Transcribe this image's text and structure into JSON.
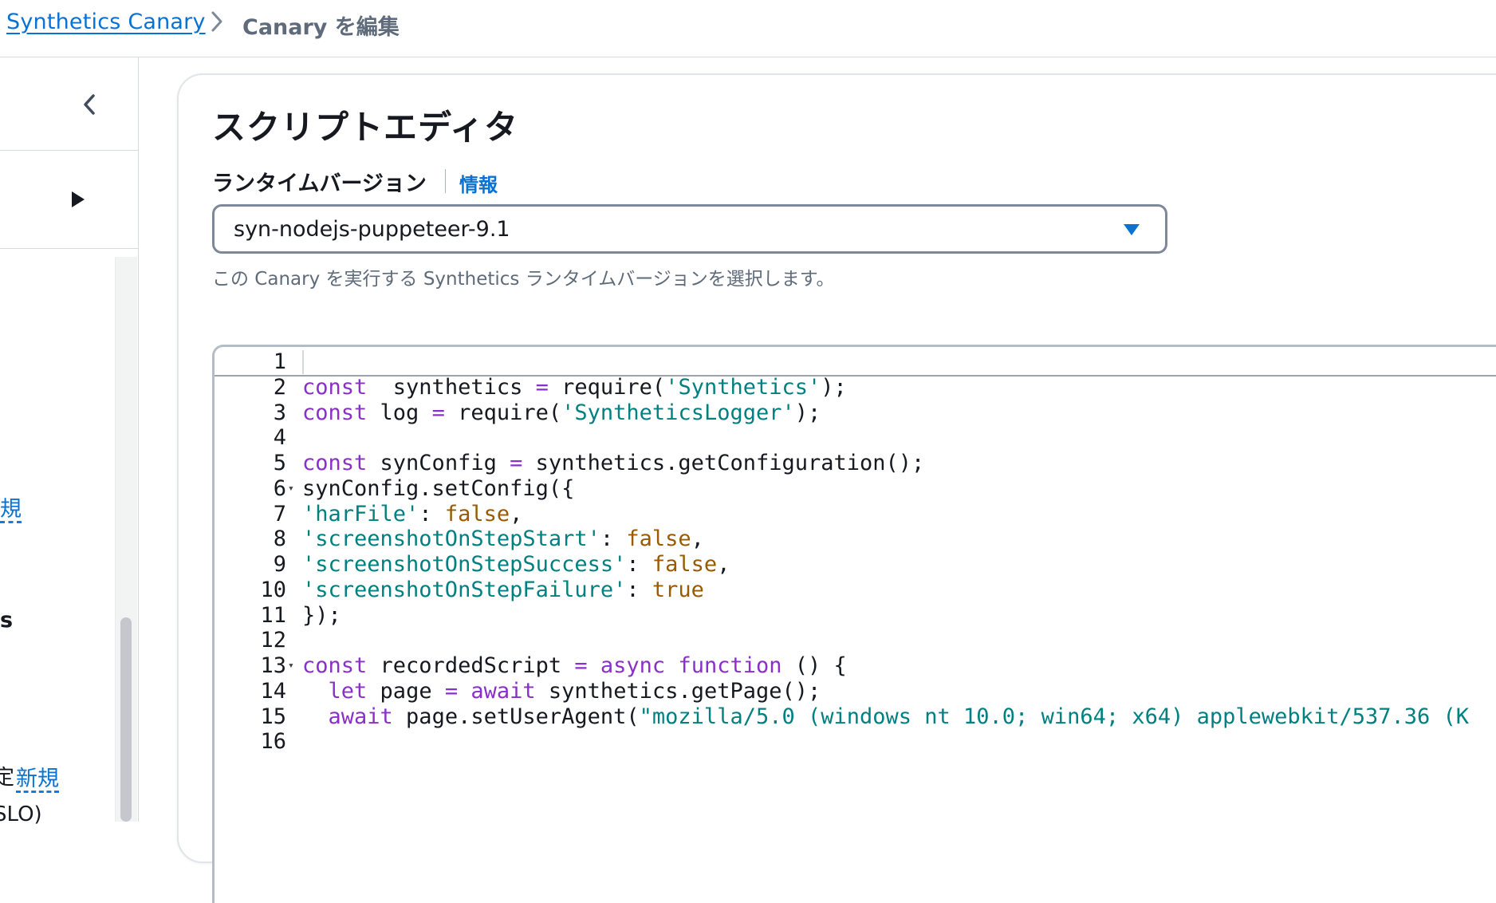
{
  "breadcrumb": {
    "parent": "Synthetics Canary",
    "current": "Canary を編集"
  },
  "sidebar": {
    "fragments": {
      "link_a": "規",
      "bold_text": "s",
      "text_b": "定",
      "link_b": "新規",
      "text_c": "SLO)"
    }
  },
  "script_editor": {
    "title": "スクリプトエディタ",
    "runtime_label": "ランタイムバージョン",
    "info_link": "情報",
    "runtime_value": "syn-nodejs-puppeteer-9.1",
    "runtime_description": "この Canary を実行する Synthetics ランタイムバージョンを選択します。"
  },
  "code": {
    "line_numbers": [
      "1",
      "2",
      "3",
      "4",
      "5",
      "6",
      "7",
      "8",
      "9",
      "10",
      "11",
      "12",
      "13",
      "14",
      "15",
      "16"
    ],
    "lines": [
      [],
      [
        [
          "kw",
          "const"
        ],
        [
          "",
          "  synthetics "
        ],
        [
          "op",
          "="
        ],
        [
          "",
          " require("
        ],
        [
          "str",
          "'Synthetics'"
        ],
        [
          "",
          ");"
        ]
      ],
      [
        [
          "kw",
          "const"
        ],
        [
          "",
          " log "
        ],
        [
          "op",
          "="
        ],
        [
          "",
          " require("
        ],
        [
          "str",
          "'SyntheticsLogger'"
        ],
        [
          "",
          ");"
        ]
      ],
      [],
      [
        [
          "kw",
          "const"
        ],
        [
          "",
          " synConfig "
        ],
        [
          "op",
          "="
        ],
        [
          "",
          " synthetics.getConfiguration();"
        ]
      ],
      [
        [
          "",
          "synConfig.setConfig({"
        ]
      ],
      [
        [
          "str",
          "'harFile'"
        ],
        [
          "",
          ": "
        ],
        [
          "lit",
          "false"
        ],
        [
          "",
          ","
        ]
      ],
      [
        [
          "str",
          "'screenshotOnStepStart'"
        ],
        [
          "",
          ": "
        ],
        [
          "lit",
          "false"
        ],
        [
          "",
          ","
        ]
      ],
      [
        [
          "str",
          "'screenshotOnStepSuccess'"
        ],
        [
          "",
          ": "
        ],
        [
          "lit",
          "false"
        ],
        [
          "",
          ","
        ]
      ],
      [
        [
          "str",
          "'screenshotOnStepFailure'"
        ],
        [
          "",
          ": "
        ],
        [
          "lit",
          "true"
        ]
      ],
      [
        [
          "",
          "});"
        ]
      ],
      [],
      [
        [
          "kw",
          "const"
        ],
        [
          "",
          " recordedScript "
        ],
        [
          "op",
          "="
        ],
        [
          "",
          " "
        ],
        [
          "kw",
          "async function"
        ],
        [
          "",
          " () {"
        ]
      ],
      [
        [
          "",
          "  "
        ],
        [
          "kw",
          "let"
        ],
        [
          "",
          " page "
        ],
        [
          "op",
          "="
        ],
        [
          "",
          " "
        ],
        [
          "kw",
          "await"
        ],
        [
          "",
          " synthetics.getPage();"
        ]
      ],
      [
        [
          "",
          "  "
        ],
        [
          "kw",
          "await"
        ],
        [
          "",
          " page.setUserAgent("
        ],
        [
          "str",
          "\"mozilla/5.0 (windows nt 10.0; win64; x64) applewebkit/537.36 (K"
        ]
      ],
      []
    ],
    "fold_markers": [
      "6",
      "13"
    ]
  }
}
